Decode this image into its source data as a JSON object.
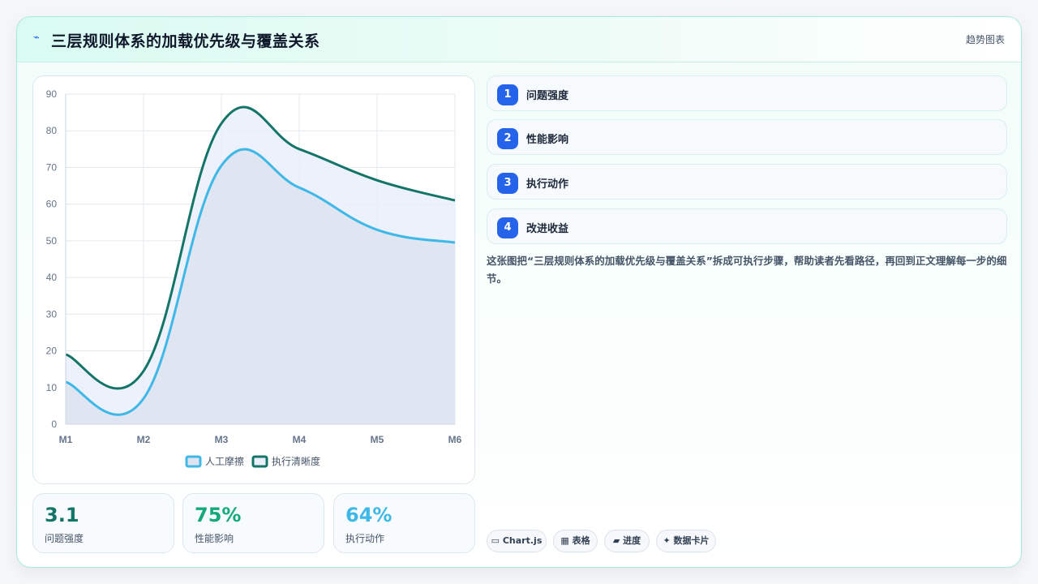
{
  "header": {
    "icon": "⌁",
    "icon_name": "trend-icon",
    "title": "三层规则体系的加载优先级与覆盖关系",
    "tag": "趋势图表"
  },
  "chart_data": {
    "type": "area",
    "categories": [
      "M1",
      "M2",
      "M3",
      "M4",
      "M5",
      "M6"
    ],
    "series": [
      {
        "name": "人工摩擦",
        "values": [
          11.5,
          7,
          70.5,
          64.5,
          53,
          49.5
        ],
        "color": "#3fb8e8",
        "fill": "#dde4ef"
      },
      {
        "name": "执行清晰度",
        "values": [
          19,
          14.5,
          82,
          75,
          66.5,
          61
        ],
        "color": "#137468",
        "fill": "#e9effb"
      }
    ],
    "ylim": [
      0,
      90
    ],
    "yticks": [
      0,
      10,
      20,
      30,
      40,
      50,
      60,
      70,
      80,
      90
    ],
    "grid": true,
    "legend_position": "bottom"
  },
  "stats": [
    {
      "value": "3.1",
      "label": "问题强度",
      "color": "#137468"
    },
    {
      "value": "75%",
      "label": "性能影响",
      "color": "#14a97a"
    },
    {
      "value": "64%",
      "label": "执行动作",
      "color": "#3fb8e8"
    }
  ],
  "steps": [
    {
      "num": "1",
      "label": "问题强度"
    },
    {
      "num": "2",
      "label": "性能影响"
    },
    {
      "num": "3",
      "label": "执行动作"
    },
    {
      "num": "4",
      "label": "改进收益"
    }
  ],
  "description": "这张图把“三层规则体系的加载优先级与覆盖关系”拆成可执行步骤，帮助读者先看路径，再回到正文理解每一步的细节。",
  "chips": [
    {
      "icon": "▭",
      "label": "Chart.js"
    },
    {
      "icon": "▦",
      "label": "表格"
    },
    {
      "icon": "▰",
      "label": "进度"
    },
    {
      "icon": "✦",
      "label": "数据卡片"
    }
  ]
}
